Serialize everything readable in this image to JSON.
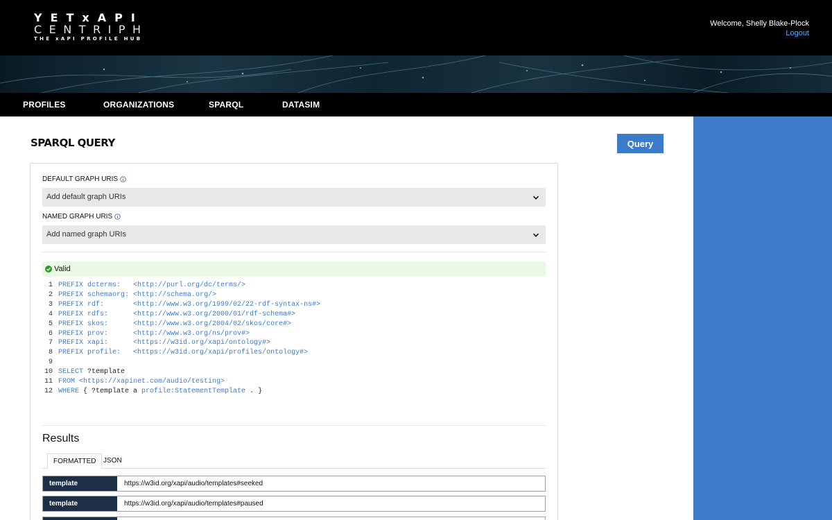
{
  "header": {
    "logo_line1": "YETxAPI",
    "logo_line2": "CENTRIPH",
    "logo_line3": "THE xAPI PROFILE HUB",
    "welcome": "Welcome, Shelly Blake-Plock",
    "logout": "Logout"
  },
  "nav": {
    "items": [
      {
        "label": "PROFILES"
      },
      {
        "label": "ORGANIZATIONS"
      },
      {
        "label": "SPARQL"
      },
      {
        "label": "DATASIM"
      }
    ]
  },
  "page": {
    "title": "SPARQL QUERY",
    "query_button": "Query"
  },
  "form": {
    "default_graph_label": "DEFAULT GRAPH URIS",
    "default_graph_placeholder": "Add default graph URIs",
    "named_graph_label": "NAMED GRAPH URIS",
    "named_graph_placeholder": "Add named graph URIs",
    "validation": "Valid"
  },
  "code": {
    "lines": [
      {
        "n": "1",
        "kw": "PREFIX dcterms:",
        "pad": "   ",
        "rest": "<http://purl.org/dc/terms/>"
      },
      {
        "n": "2",
        "kw": "PREFIX schemaorg:",
        "pad": " ",
        "rest": "<http://schema.org/>"
      },
      {
        "n": "3",
        "kw": "PREFIX rdf:",
        "pad": "       ",
        "rest": "<http://www.w3.org/1999/02/22-rdf-syntax-ns#>"
      },
      {
        "n": "4",
        "kw": "PREFIX rdfs:",
        "pad": "      ",
        "rest": "<http://www.w3.org/2000/01/rdf-schema#>"
      },
      {
        "n": "5",
        "kw": "PREFIX skos:",
        "pad": "      ",
        "rest": "<http://www.w3.org/2004/02/skos/core#>"
      },
      {
        "n": "6",
        "kw": "PREFIX prov:",
        "pad": "      ",
        "rest": "<http://www.w3.org/ns/prov#>"
      },
      {
        "n": "7",
        "kw": "PREFIX xapi:",
        "pad": "      ",
        "rest": "<https://w3id.org/xapi/ontology#>"
      },
      {
        "n": "8",
        "kw": "PREFIX profile:",
        "pad": "   ",
        "rest": "<https://w3id.org/xapi/profiles/ontology#>"
      },
      {
        "n": "9",
        "kw": "",
        "pad": "",
        "rest": ""
      }
    ],
    "line10": {
      "n": "10",
      "kw": "SELECT",
      "rest": " ?template"
    },
    "line11": {
      "n": "11",
      "kw": "FROM",
      "rest": " <https://xapinet.com/audio/testing>"
    },
    "line12": {
      "n": "12",
      "kw": "WHERE",
      "a": " { ?template a ",
      "b": "profile:StatementTemplate",
      "c": " . }"
    }
  },
  "results": {
    "title": "Results",
    "tab_formatted": "FORMATTED",
    "tab_json": "JSON",
    "rows": [
      {
        "key": "template",
        "value": "https://w3id.org/xapi/audio/templates#seeked"
      },
      {
        "key": "template",
        "value": "https://w3id.org/xapi/audio/templates#paused"
      },
      {
        "key": "",
        "value": ""
      }
    ]
  }
}
